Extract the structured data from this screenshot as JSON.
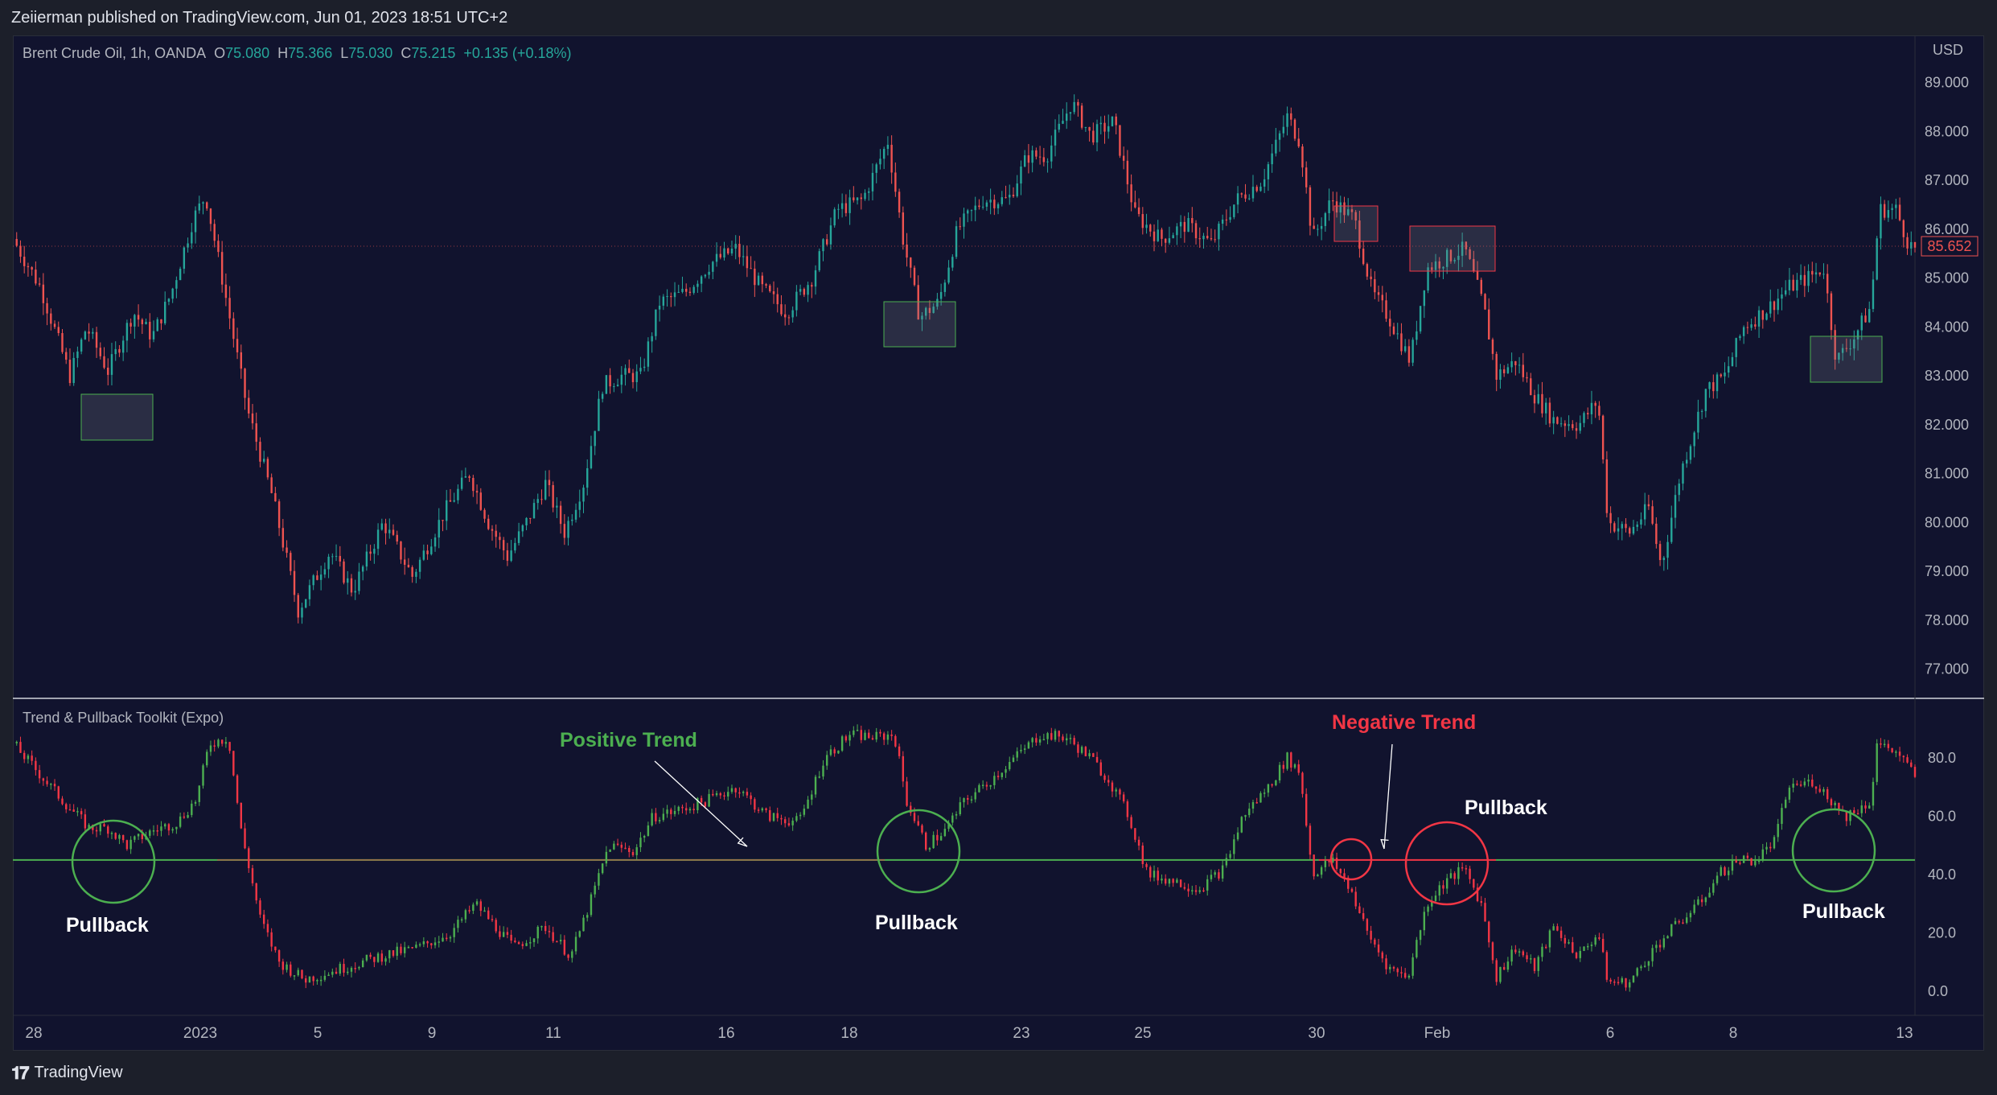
{
  "header": {
    "published": "Zeiierman published on TradingView.com, Jun 01, 2023 18:51 UTC+2"
  },
  "legend": {
    "symbol": "Brent Crude Oil, 1h, OANDA",
    "o_label": "O",
    "o_val": "75.080",
    "h_label": "H",
    "h_val": "75.366",
    "l_label": "L",
    "l_val": "75.030",
    "c_label": "C",
    "c_val": "75.215",
    "change": "+0.135 (+0.18%)"
  },
  "indicator": {
    "title": "Trend & Pullback Toolkit (Expo)"
  },
  "annotations": {
    "positive_trend": "Positive Trend",
    "negative_trend": "Negative Trend",
    "pullback": "Pullback"
  },
  "footer": {
    "brand": "TradingView"
  },
  "colors": {
    "bull": "#26a69a",
    "bear": "#ef5350",
    "ind_up": "#4caf50",
    "ind_down": "#f23645",
    "background": "#11132e",
    "positive_text": "#4caf50",
    "negative_text": "#f23645"
  },
  "chart_data": [
    {
      "type": "candlestick",
      "title": "Brent Crude Oil, 1h, OANDA",
      "ylabel": "USD",
      "ylim": [
        77.0,
        89.0
      ],
      "y_ticks": [
        "89.000",
        "88.000",
        "87.000",
        "86.000",
        "85.000",
        "84.000",
        "83.000",
        "82.000",
        "81.000",
        "80.000",
        "79.000",
        "78.000",
        "77.000"
      ],
      "x_ticks": [
        "28",
        "2023",
        "5",
        "9",
        "11",
        "16",
        "18",
        "23",
        "25",
        "30",
        "Feb",
        "6",
        "8",
        "13"
      ],
      "last_price": "85.652",
      "path_points": [
        [
          0,
          85.8
        ],
        [
          22,
          84.8
        ],
        [
          45,
          83.0
        ],
        [
          58,
          84.0
        ],
        [
          75,
          83.1
        ],
        [
          95,
          84.3
        ],
        [
          110,
          83.8
        ],
        [
          125,
          84.7
        ],
        [
          142,
          86.2
        ],
        [
          152,
          86.7
        ],
        [
          165,
          85.0
        ],
        [
          185,
          82.3
        ],
        [
          205,
          80.5
        ],
        [
          225,
          78.2
        ],
        [
          250,
          79.4
        ],
        [
          268,
          78.6
        ],
        [
          292,
          80.0
        ],
        [
          315,
          78.9
        ],
        [
          340,
          80.2
        ],
        [
          360,
          81.0
        ],
        [
          375,
          80.0
        ],
        [
          390,
          79.3
        ],
        [
          405,
          80.0
        ],
        [
          420,
          80.8
        ],
        [
          435,
          79.8
        ],
        [
          450,
          80.8
        ],
        [
          465,
          82.8
        ],
        [
          480,
          83.0
        ],
        [
          495,
          83.0
        ],
        [
          510,
          84.5
        ],
        [
          530,
          84.7
        ],
        [
          550,
          85.3
        ],
        [
          570,
          85.6
        ],
        [
          590,
          84.8
        ],
        [
          610,
          84.3
        ],
        [
          630,
          85.0
        ],
        [
          650,
          86.4
        ],
        [
          670,
          86.6
        ],
        [
          690,
          87.8
        ],
        [
          702,
          85.8
        ],
        [
          715,
          84.2
        ],
        [
          730,
          84.5
        ],
        [
          745,
          86.0
        ],
        [
          765,
          86.6
        ],
        [
          785,
          86.6
        ],
        [
          800,
          87.5
        ],
        [
          815,
          87.5
        ],
        [
          835,
          88.6
        ],
        [
          850,
          87.9
        ],
        [
          868,
          88.2
        ],
        [
          885,
          86.3
        ],
        [
          905,
          85.8
        ],
        [
          925,
          86.1
        ],
        [
          945,
          85.7
        ],
        [
          965,
          86.6
        ],
        [
          985,
          87.0
        ],
        [
          1005,
          88.3
        ],
        [
          1015,
          87.8
        ],
        [
          1025,
          85.8
        ],
        [
          1040,
          86.6
        ],
        [
          1058,
          86.2
        ],
        [
          1072,
          84.7
        ],
        [
          1085,
          84.2
        ],
        [
          1102,
          83.3
        ],
        [
          1115,
          85.2
        ],
        [
          1130,
          85.4
        ],
        [
          1145,
          85.6
        ],
        [
          1160,
          84.4
        ],
        [
          1170,
          83.0
        ],
        [
          1185,
          83.3
        ],
        [
          1200,
          82.6
        ],
        [
          1215,
          82.1
        ],
        [
          1235,
          82.0
        ],
        [
          1250,
          82.5
        ],
        [
          1258,
          80.0
        ],
        [
          1275,
          79.8
        ],
        [
          1290,
          80.3
        ],
        [
          1300,
          79.1
        ],
        [
          1315,
          81.0
        ],
        [
          1335,
          82.7
        ],
        [
          1350,
          83.0
        ],
        [
          1365,
          84.0
        ],
        [
          1385,
          84.4
        ],
        [
          1400,
          84.8
        ],
        [
          1415,
          85.0
        ],
        [
          1428,
          85.2
        ],
        [
          1438,
          83.3
        ],
        [
          1452,
          83.8
        ],
        [
          1465,
          84.4
        ],
        [
          1472,
          86.4
        ],
        [
          1485,
          86.4
        ],
        [
          1495,
          85.7
        ],
        [
          1500,
          85.6
        ]
      ]
    },
    {
      "type": "line",
      "title": "Trend & Pullback Toolkit (Expo)",
      "ylim": [
        0.0,
        80.0
      ],
      "y_ticks": [
        "80.0",
        "60.0",
        "40.0",
        "20.0",
        "0.0"
      ],
      "baseline_value": 45,
      "path_points": [
        [
          0,
          85
        ],
        [
          20,
          75
        ],
        [
          40,
          65
        ],
        [
          60,
          56
        ],
        [
          75,
          56
        ],
        [
          90,
          50
        ],
        [
          110,
          55
        ],
        [
          130,
          58
        ],
        [
          145,
          66
        ],
        [
          155,
          85
        ],
        [
          170,
          87
        ],
        [
          180,
          55
        ],
        [
          195,
          25
        ],
        [
          210,
          10
        ],
        [
          230,
          4
        ],
        [
          260,
          8
        ],
        [
          290,
          12
        ],
        [
          320,
          15
        ],
        [
          345,
          20
        ],
        [
          365,
          30
        ],
        [
          375,
          25
        ],
        [
          395,
          15
        ],
        [
          420,
          22
        ],
        [
          440,
          12
        ],
        [
          455,
          30
        ],
        [
          470,
          50
        ],
        [
          490,
          48
        ],
        [
          505,
          60
        ],
        [
          525,
          62
        ],
        [
          545,
          65
        ],
        [
          570,
          70
        ],
        [
          595,
          60
        ],
        [
          620,
          58
        ],
        [
          640,
          80
        ],
        [
          660,
          88
        ],
        [
          680,
          87
        ],
        [
          695,
          88
        ],
        [
          705,
          65
        ],
        [
          720,
          50
        ],
        [
          735,
          55
        ],
        [
          750,
          65
        ],
        [
          770,
          72
        ],
        [
          790,
          80
        ],
        [
          810,
          88
        ],
        [
          830,
          87
        ],
        [
          850,
          80
        ],
        [
          865,
          72
        ],
        [
          880,
          60
        ],
        [
          895,
          40
        ],
        [
          915,
          38
        ],
        [
          935,
          35
        ],
        [
          955,
          42
        ],
        [
          970,
          60
        ],
        [
          990,
          70
        ],
        [
          1005,
          80
        ],
        [
          1015,
          75
        ],
        [
          1025,
          40
        ],
        [
          1040,
          45
        ],
        [
          1055,
          35
        ],
        [
          1068,
          20
        ],
        [
          1085,
          8
        ],
        [
          1100,
          5
        ],
        [
          1115,
          30
        ],
        [
          1130,
          38
        ],
        [
          1145,
          42
        ],
        [
          1158,
          30
        ],
        [
          1170,
          5
        ],
        [
          1185,
          15
        ],
        [
          1200,
          8
        ],
        [
          1215,
          22
        ],
        [
          1235,
          12
        ],
        [
          1250,
          20
        ],
        [
          1258,
          3
        ],
        [
          1275,
          3
        ],
        [
          1295,
          15
        ],
        [
          1310,
          22
        ],
        [
          1330,
          30
        ],
        [
          1345,
          40
        ],
        [
          1360,
          45
        ],
        [
          1375,
          45
        ],
        [
          1390,
          52
        ],
        [
          1400,
          70
        ],
        [
          1420,
          72
        ],
        [
          1435,
          65
        ],
        [
          1445,
          60
        ],
        [
          1465,
          65
        ],
        [
          1470,
          85
        ],
        [
          1485,
          82
        ],
        [
          1500,
          74
        ]
      ]
    }
  ]
}
